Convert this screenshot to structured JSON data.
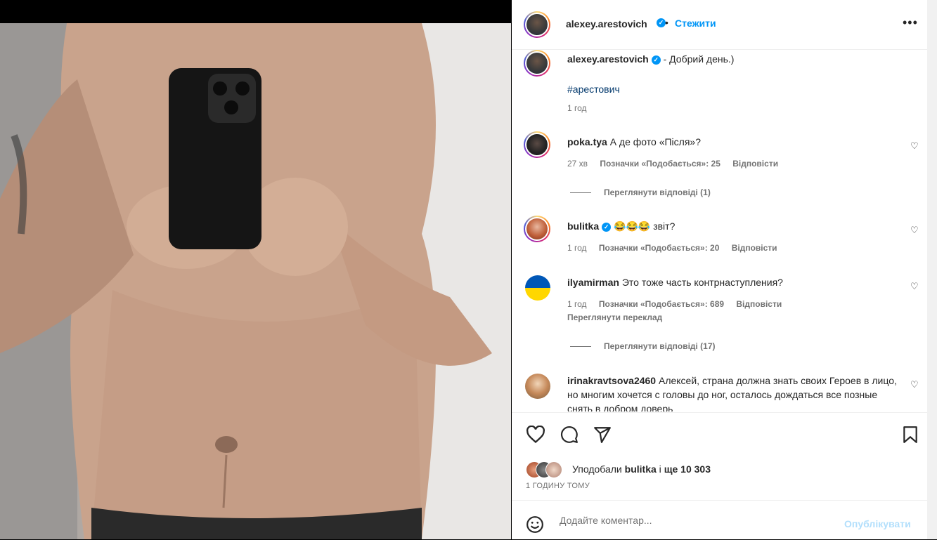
{
  "post": {
    "author": "alexey.arestovich",
    "follow_label": "Стежити",
    "dot": "•",
    "more": "•••",
    "caption_text": "- Добрий день.)",
    "hashtag": "#арестович",
    "caption_time": "1 год"
  },
  "comments": [
    {
      "user": "poka.tya",
      "text": "А де фото «Після»?",
      "time": "27 хв",
      "likes": "Позначки «Подобається»: 25",
      "reply": "Відповісти",
      "view_replies": "Переглянути відповіді (1)"
    },
    {
      "user": "bulitka",
      "emoji": "😂😂😂",
      "text": "звіт?",
      "time": "1 год",
      "likes": "Позначки «Подобається»: 20",
      "reply": "Відповісти"
    },
    {
      "user": "ilyamirman",
      "text": "Это тоже часть контрнаступления?",
      "time": "1 год",
      "likes": "Позначки «Подобається»: 689",
      "reply": "Відповісти",
      "translate": "Переглянути переклад",
      "view_replies": "Переглянути відповіді (17)"
    },
    {
      "user": "irinakravtsova2460",
      "text": "Алексей, страна должна знать своих Героев в лицо, но многим хочется с головы до ног, осталось дождаться все позные снять в добром доверь"
    }
  ],
  "likes_summary": {
    "prefix": "Уподобали",
    "user": "bulitka",
    "middle": "і",
    "rest": "ще 10 303"
  },
  "posted_time": "1 ГОДИНУ ТОМУ",
  "add_comment": {
    "placeholder": "Додайте коментар...",
    "publish": "Опублікувати"
  },
  "colors": {
    "accent": "#0095f6",
    "publish_disabled": "#b2dffc",
    "text": "#262626",
    "muted": "#737373"
  },
  "icons": [
    "heart-icon",
    "comment-icon",
    "share-icon",
    "bookmark-icon",
    "emoji-icon",
    "verified-icon",
    "more-icon"
  ]
}
